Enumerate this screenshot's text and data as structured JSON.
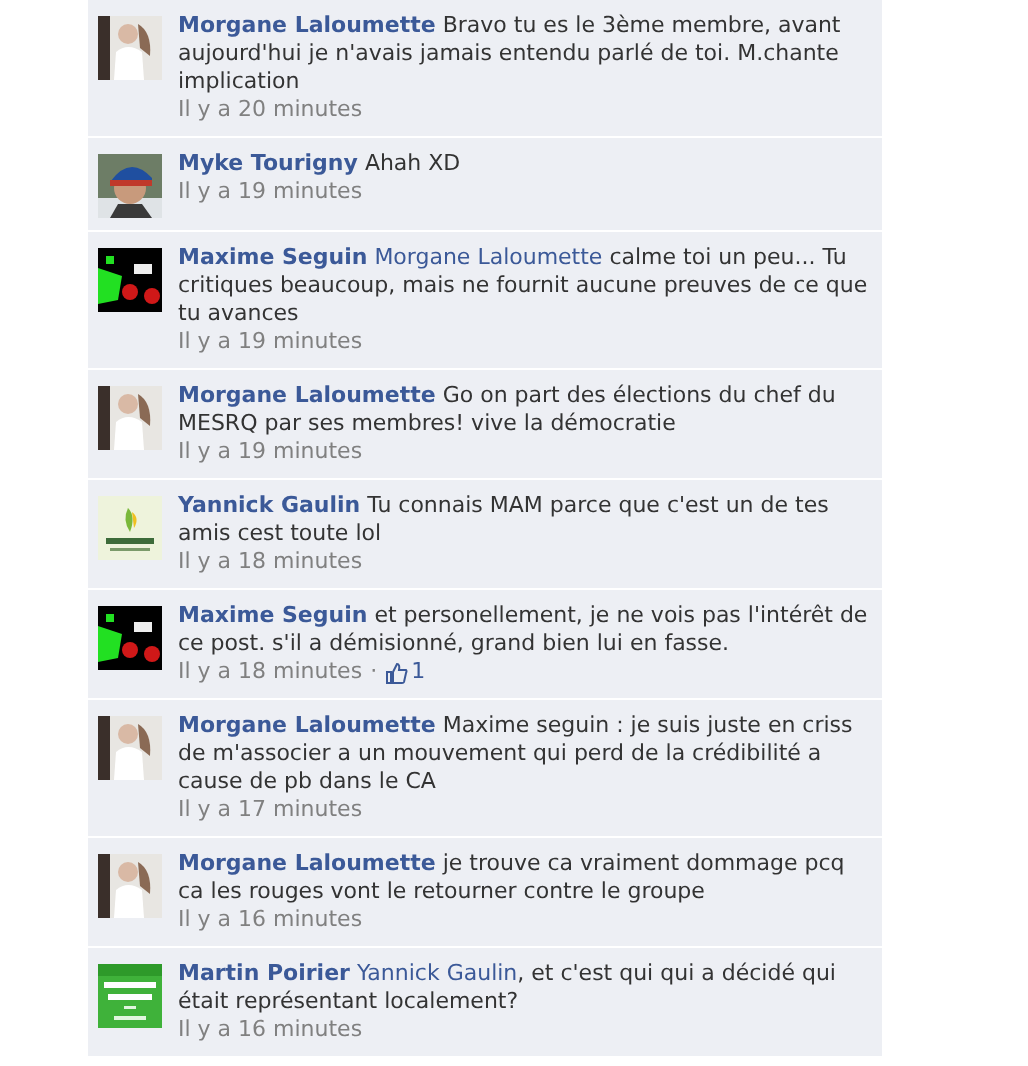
{
  "comments": [
    {
      "author": "Morgane Laloumette",
      "text": "Bravo tu es le 3ème membre, avant aujourd'hui je n'avais jamais entendu parlé de toi. M.chante implication",
      "time": "Il y a 20 minutes"
    },
    {
      "author": "Myke Tourigny",
      "text": "Ahah XD",
      "time": "Il y a 19 minutes"
    },
    {
      "author": "Maxime Seguin",
      "mention": "Morgane Laloumette",
      "text": " calme toi un peu... Tu critiques beaucoup, mais ne fournit aucune preuves de ce que tu avances",
      "time": "Il y a 19 minutes"
    },
    {
      "author": "Morgane Laloumette",
      "text": "Go on part des élections du chef du MESRQ par ses membres! vive la démocratie",
      "time": "Il y a 19 minutes"
    },
    {
      "author": "Yannick Gaulin",
      "text": "Tu connais MAM parce que c'est un de tes amis cest toute lol",
      "time": "Il y a 18 minutes"
    },
    {
      "author": "Maxime Seguin",
      "text": "et personellement, je ne vois pas l'intérêt de ce post. s'il a démisionné, grand bien lui en fasse.",
      "time": "Il y a 18 minutes",
      "separator": "·",
      "likes": "1"
    },
    {
      "author": "Morgane Laloumette",
      "text": "Maxime seguin : je suis juste en criss de m'associer a un mouvement qui perd de la crédibilité a cause de pb dans le CA",
      "time": "Il y a 17 minutes"
    },
    {
      "author": "Morgane Laloumette",
      "text": "je trouve ca vraiment dommage pcq ca les rouges vont le retourner contre le groupe",
      "time": "Il y a 16 minutes"
    },
    {
      "author": "Martin Poirier",
      "mention": "Yannick Gaulin",
      "text": ", et c'est qui qui a décidé qui était représentant localement?",
      "time": "Il y a 16 minutes"
    }
  ]
}
